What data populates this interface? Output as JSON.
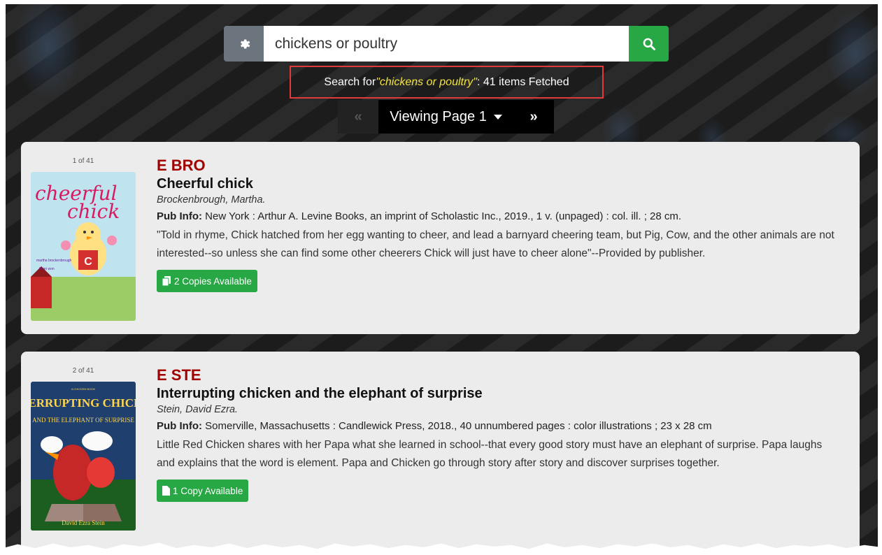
{
  "search": {
    "value": "chickens or poultry",
    "settings_icon": "gear-icon",
    "search_icon": "search-icon"
  },
  "status": {
    "prefix": "Search for ",
    "query": "\"chickens or poultry\"",
    "suffix": ": 41 items Fetched"
  },
  "pager": {
    "prev_label": "«",
    "page_label": "Viewing Page 1",
    "next_label": "»"
  },
  "results": [
    {
      "counter": "1 of 41",
      "call_number": "E BRO",
      "title": "Cheerful chick",
      "author": "Brockenbrough, Martha.",
      "pub_label": "Pub Info:",
      "pub_info": "New York : Arthur A. Levine Books, an imprint of Scholastic Inc., 2019., 1 v. (unpaged) : col. ill. ; 28 cm.",
      "description": "\"Told in rhyme, Chick hatched from her egg wanting to cheer, and lead a barnyard cheering team, but Pig, Cow, and the other animals are not interested--so unless she can find some other cheerers Chick will just have to cheer alone\"--Provided by publisher.",
      "copies": "2 Copies Available",
      "cover_title": "cheerful chick",
      "cover_byline": "martha brockenbrough / brian won"
    },
    {
      "counter": "2 of 41",
      "call_number": "E STE",
      "title": "Interrupting chicken and the elephant of surprise",
      "author": "Stein, David Ezra.",
      "pub_label": "Pub Info:",
      "pub_info": "Somerville, Massachusetts : Candlewick Press, 2018., 40 unnumbered pages : color illustrations ; 23 x 28 cm",
      "description": "Little Red Chicken shares with her Papa what she learned in school--that every good story must have an elephant of surprise. Papa laughs and explains that the word is element. Papa and Chicken go through story after story and discover surprises together.",
      "copies": "1 Copy Available",
      "cover_title": "INTERRUPTING CHICKEN",
      "cover_subtitle": "AND THE ELEPHANT OF SURPRISE",
      "cover_byline": "David Ezra Stein"
    }
  ],
  "colors": {
    "accent_green": "#28a745",
    "call_number_red": "#a00000",
    "highlight_box": "#e03a3a",
    "query_yellow": "#f2e340"
  }
}
